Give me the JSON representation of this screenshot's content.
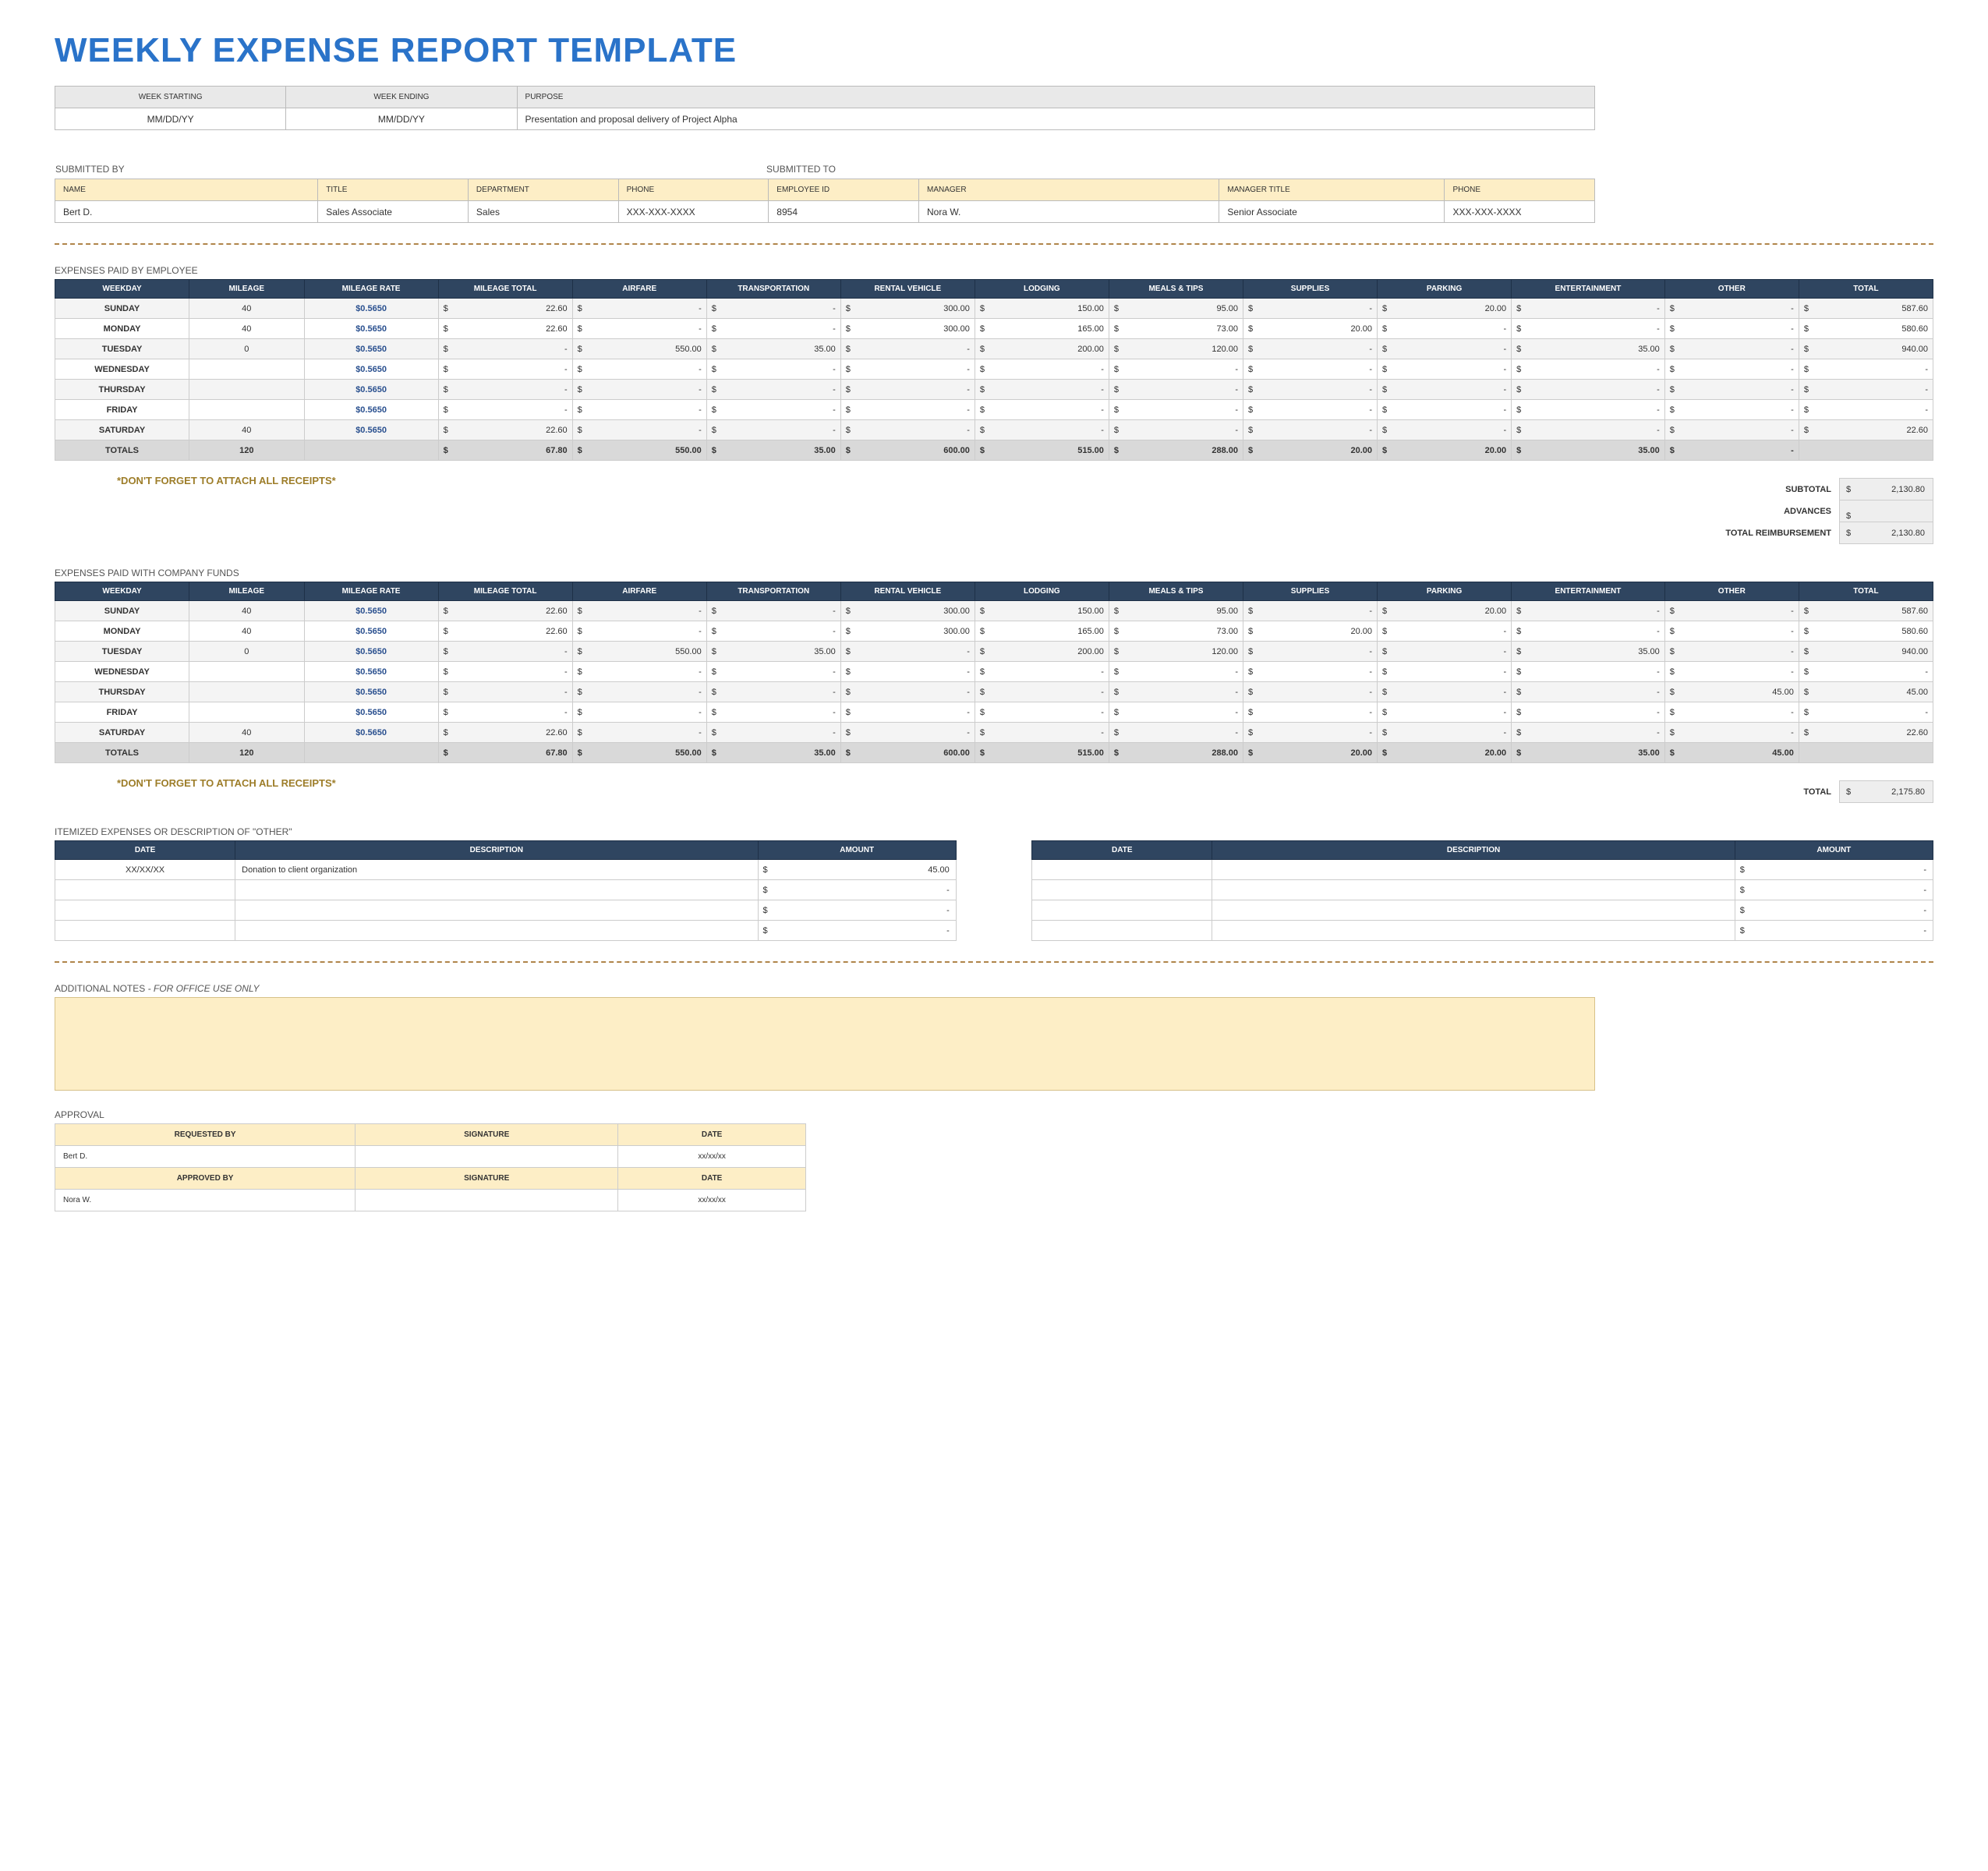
{
  "title": "WEEKLY EXPENSE REPORT TEMPLATE",
  "header_info": {
    "labels": {
      "week_start": "WEEK STARTING",
      "week_end": "WEEK ENDING",
      "purpose": "PURPOSE"
    },
    "values": {
      "week_start": "MM/DD/YY",
      "week_end": "MM/DD/YY",
      "purpose": "Presentation and proposal delivery of Project Alpha"
    }
  },
  "submitted": {
    "by_title": "SUBMITTED BY",
    "to_title": "SUBMITTED TO",
    "by_labels": {
      "name": "NAME",
      "title": "TITLE",
      "dept": "DEPARTMENT",
      "phone": "PHONE",
      "empid": "EMPLOYEE ID"
    },
    "by": {
      "name": "Bert D.",
      "title": "Sales Associate",
      "dept": "Sales",
      "phone": "XXX-XXX-XXXX",
      "empid": "8954"
    },
    "to_labels": {
      "manager": "MANAGER",
      "mtitle": "MANAGER TITLE",
      "phone": "PHONE"
    },
    "to": {
      "manager": "Nora W.",
      "mtitle": "Senior Associate",
      "phone": "XXX-XXX-XXXX"
    }
  },
  "exp_cols": [
    "WEEKDAY",
    "MILEAGE",
    "MILEAGE RATE",
    "MILEAGE TOTAL",
    "AIRFARE",
    "TRANSPORTATION",
    "RENTAL VEHICLE",
    "LODGING",
    "MEALS & TIPS",
    "SUPPLIES",
    "PARKING",
    "ENTERTAINMENT",
    "OTHER",
    "TOTAL"
  ],
  "weekdays": [
    "SUNDAY",
    "MONDAY",
    "TUESDAY",
    "WEDNESDAY",
    "THURSDAY",
    "FRIDAY",
    "SATURDAY"
  ],
  "mileage_rate": "$0.5650",
  "employee": {
    "section": "EXPENSES PAID BY EMPLOYEE",
    "rows": [
      {
        "mileage": "40",
        "mtot": "22.60",
        "air": "-",
        "trans": "-",
        "rental": "300.00",
        "lodg": "150.00",
        "meals": "95.00",
        "supp": "-",
        "park": "20.00",
        "ent": "-",
        "other": "-",
        "total": "587.60"
      },
      {
        "mileage": "40",
        "mtot": "22.60",
        "air": "-",
        "trans": "-",
        "rental": "300.00",
        "lodg": "165.00",
        "meals": "73.00",
        "supp": "20.00",
        "park": "-",
        "ent": "-",
        "other": "-",
        "total": "580.60"
      },
      {
        "mileage": "0",
        "mtot": "-",
        "air": "550.00",
        "trans": "35.00",
        "rental": "-",
        "lodg": "200.00",
        "meals": "120.00",
        "supp": "-",
        "park": "-",
        "ent": "35.00",
        "other": "-",
        "total": "940.00"
      },
      {
        "mileage": "",
        "mtot": "-",
        "air": "-",
        "trans": "-",
        "rental": "-",
        "lodg": "-",
        "meals": "-",
        "supp": "-",
        "park": "-",
        "ent": "-",
        "other": "-",
        "total": "-"
      },
      {
        "mileage": "",
        "mtot": "-",
        "air": "-",
        "trans": "-",
        "rental": "-",
        "lodg": "-",
        "meals": "-",
        "supp": "-",
        "park": "-",
        "ent": "-",
        "other": "-",
        "total": "-"
      },
      {
        "mileage": "",
        "mtot": "-",
        "air": "-",
        "trans": "-",
        "rental": "-",
        "lodg": "-",
        "meals": "-",
        "supp": "-",
        "park": "-",
        "ent": "-",
        "other": "-",
        "total": "-"
      },
      {
        "mileage": "40",
        "mtot": "22.60",
        "air": "-",
        "trans": "-",
        "rental": "-",
        "lodg": "-",
        "meals": "-",
        "supp": "-",
        "park": "-",
        "ent": "-",
        "other": "-",
        "total": "22.60"
      }
    ],
    "totals": {
      "mileage": "120",
      "mtot": "67.80",
      "air": "550.00",
      "trans": "35.00",
      "rental": "600.00",
      "lodg": "515.00",
      "meals": "288.00",
      "supp": "20.00",
      "park": "20.00",
      "ent": "35.00",
      "other": "-"
    },
    "summary": {
      "subtotal_lbl": "SUBTOTAL",
      "subtotal": "2,130.80",
      "advances_lbl": "ADVANCES",
      "advances": "",
      "reimb_lbl": "TOTAL REIMBURSEMENT",
      "reimb": "2,130.80"
    }
  },
  "company": {
    "section": "EXPENSES PAID WITH COMPANY FUNDS",
    "rows": [
      {
        "mileage": "40",
        "mtot": "22.60",
        "air": "-",
        "trans": "-",
        "rental": "300.00",
        "lodg": "150.00",
        "meals": "95.00",
        "supp": "-",
        "park": "20.00",
        "ent": "-",
        "other": "-",
        "total": "587.60"
      },
      {
        "mileage": "40",
        "mtot": "22.60",
        "air": "-",
        "trans": "-",
        "rental": "300.00",
        "lodg": "165.00",
        "meals": "73.00",
        "supp": "20.00",
        "park": "-",
        "ent": "-",
        "other": "-",
        "total": "580.60"
      },
      {
        "mileage": "0",
        "mtot": "-",
        "air": "550.00",
        "trans": "35.00",
        "rental": "-",
        "lodg": "200.00",
        "meals": "120.00",
        "supp": "-",
        "park": "-",
        "ent": "35.00",
        "other": "-",
        "total": "940.00"
      },
      {
        "mileage": "",
        "mtot": "-",
        "air": "-",
        "trans": "-",
        "rental": "-",
        "lodg": "-",
        "meals": "-",
        "supp": "-",
        "park": "-",
        "ent": "-",
        "other": "-",
        "total": "-"
      },
      {
        "mileage": "",
        "mtot": "-",
        "air": "-",
        "trans": "-",
        "rental": "-",
        "lodg": "-",
        "meals": "-",
        "supp": "-",
        "park": "-",
        "ent": "-",
        "other": "45.00",
        "total": "45.00"
      },
      {
        "mileage": "",
        "mtot": "-",
        "air": "-",
        "trans": "-",
        "rental": "-",
        "lodg": "-",
        "meals": "-",
        "supp": "-",
        "park": "-",
        "ent": "-",
        "other": "-",
        "total": "-"
      },
      {
        "mileage": "40",
        "mtot": "22.60",
        "air": "-",
        "trans": "-",
        "rental": "-",
        "lodg": "-",
        "meals": "-",
        "supp": "-",
        "park": "-",
        "ent": "-",
        "other": "-",
        "total": "22.60"
      }
    ],
    "totals": {
      "mileage": "120",
      "mtot": "67.80",
      "air": "550.00",
      "trans": "35.00",
      "rental": "600.00",
      "lodg": "515.00",
      "meals": "288.00",
      "supp": "20.00",
      "park": "20.00",
      "ent": "35.00",
      "other": "45.00"
    },
    "summary": {
      "total_lbl": "TOTAL",
      "total": "2,175.80"
    }
  },
  "reminder": "*DON'T FORGET TO ATTACH ALL RECEIPTS*",
  "itemized": {
    "section": "ITEMIZED EXPENSES OR DESCRIPTION OF \"OTHER\"",
    "cols": {
      "date": "DATE",
      "desc": "DESCRIPTION",
      "amount": "AMOUNT"
    },
    "left": [
      {
        "date": "XX/XX/XX",
        "desc": "Donation to client organization",
        "amount": "45.00"
      },
      {
        "date": "",
        "desc": "",
        "amount": "-"
      },
      {
        "date": "",
        "desc": "",
        "amount": "-"
      },
      {
        "date": "",
        "desc": "",
        "amount": "-"
      }
    ],
    "right": [
      {
        "date": "",
        "desc": "",
        "amount": "-"
      },
      {
        "date": "",
        "desc": "",
        "amount": "-"
      },
      {
        "date": "",
        "desc": "",
        "amount": "-"
      },
      {
        "date": "",
        "desc": "",
        "amount": "-"
      }
    ]
  },
  "notes": {
    "section": "ADDITIONAL NOTES",
    "suffix": " - FOR OFFICE USE ONLY"
  },
  "approval": {
    "section": "APPROVAL",
    "labels": {
      "req": "REQUESTED BY",
      "sig": "SIGNATURE",
      "date": "DATE",
      "apr": "APPROVED BY"
    },
    "req": {
      "name": "Bert D.",
      "sig": "",
      "date": "xx/xx/xx"
    },
    "apr": {
      "name": "Nora W.",
      "sig": "",
      "date": "xx/xx/xx"
    }
  },
  "totals_label": "TOTALS"
}
